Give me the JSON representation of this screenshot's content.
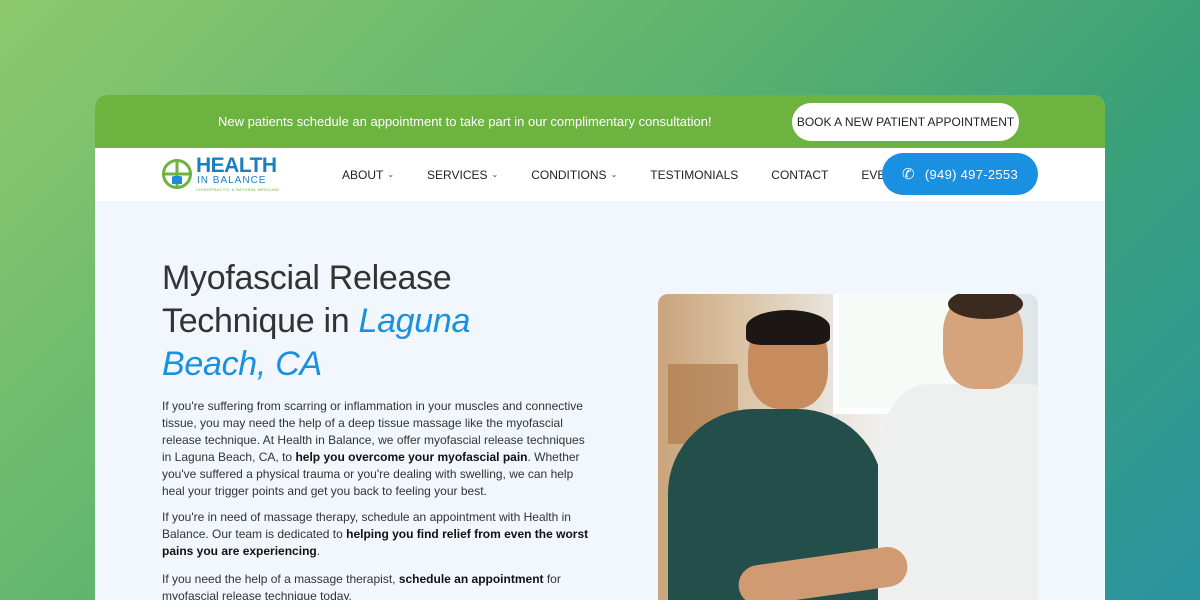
{
  "topbar": {
    "announcement": "New patients schedule an appointment to take part in our complimentary consultation!",
    "book_label": "BOOK A NEW PATIENT APPOINTMENT"
  },
  "logo": {
    "health": "HEALTH",
    "balance": "IN BALANCE",
    "sub": "CHIROPRACTIC & NATURAL MEDICINE"
  },
  "nav": {
    "items": [
      {
        "label": "ABOUT",
        "dropdown": true
      },
      {
        "label": "SERVICES",
        "dropdown": true
      },
      {
        "label": "CONDITIONS",
        "dropdown": true
      },
      {
        "label": "TESTIMONIALS",
        "dropdown": false
      },
      {
        "label": "CONTACT",
        "dropdown": false
      },
      {
        "label": "EVENTS",
        "dropdown": false
      }
    ],
    "phone": "(949) 497-2553"
  },
  "hero": {
    "title_plain": "Myofascial Release Technique in ",
    "title_accent": "Laguna Beach, CA",
    "p1_a": "If you're suffering from scarring or inflammation in your muscles and connective tissue, you may need the help of a deep tissue massage like the myofascial release technique. At Health in Balance, we offer myofascial release techniques in Laguna Beach, CA, to ",
    "p1_b": "help you overcome your myofascial pain",
    "p1_c": ". Whether you've suffered a physical trauma or you're dealing with swelling, we can help heal your trigger points and get you back to feeling your best.",
    "p2_a": "If you're in need of massage therapy, schedule an appointment with Health in Balance. Our team is dedicated to ",
    "p2_b": "helping you find relief from even the worst pains you are experiencing",
    "p2_c": ".",
    "p3_a": "If you need the help of a massage therapist, ",
    "p3_b": "schedule an appointment",
    "p3_c": " for myofascial release technique today."
  },
  "colors": {
    "topbar": "#6cb33f",
    "accent_blue": "#1a90e0",
    "page_bg": "#f1f7fd"
  }
}
